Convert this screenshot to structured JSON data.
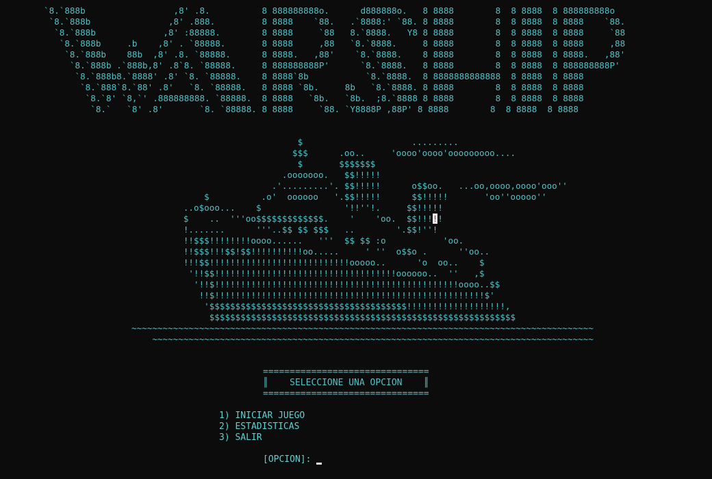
{
  "title_art": [
    "`8.`888b                 ,8' .8.          8 888888888o.      d888888o.   8 8888        8  8 8888  8 888888888o",
    " `8.`888b               ,8' .888.         8 8888    `88.   .`8888:' `88. 8 8888        8  8 8888  8 8888    `88.",
    "  `8.`888b             ,8' :88888.        8 8888     `88   8.`8888.   Y8 8 8888        8  8 8888  8 8888     `88",
    "   `8.`888b     .b    ,8' . `88888.       8 8888     ,88   `8.`8888.     8 8888        8  8 8888  8 8888     ,88",
    "    `8.`888b    88b  ,8' .8. `88888.      8 8888.   ,88'    `8.`8888.    8 8888        8  8 8888  8 8888.   ,88'",
    "     `8.`888b .`888b,8' .8`8. `88888.     8 888888888P'      `8.`8888.   8 8888        8  8 8888  8 888888888P'",
    "      `8.`888b8.`8888' .8' `8. `88888.    8 8888`8b           `8.`8888.  8 8888888888888  8 8888  8 8888",
    "       `8.`888`8.`88' .8'   `8. `88888.   8 8888 `8b.     8b   `8.`8888. 8 8888        8  8 8888  8 8888",
    "        `8.`8' `8,`' .888888888. `88888.  8 8888   `8b.   `8b.  ;8.`8888 8 8888        8  8 8888  8 8888",
    "         `8.`   `8' .8'       `8. `88888. 8 8888     `88. `Y8888P ,88P' 8 8888        8  8 8888  8 8888"
  ],
  "ship_art_before_cursor": [
    "                                $                     .........",
    "                               $$$      .oo..     'oooo'oooo'ooooooooo....",
    "                                $       $$$$$$$",
    "                             .ooooooo.   $$!!!!!",
    "                           .'.........'. $$!!!!!      o$$oo.   ...oo,oooo,oooo'ooo''",
    "              $          .o'  oooooo   '.$$!!!!!      $$!!!!!       'oo''ooooo''",
    "          ..o$ooo...    $                '!!''!.     $$!!!!!",
    "          $    ..  '''oo$$$$$$$$$$$$$.    '    'oo.  $$!!!"
  ],
  "ship_cursor_char": "!",
  "ship_cursor_after": "!",
  "ship_art_after": [
    "          !.......      '''..$$ $$ $$$   ..        '.$$!''!",
    "          !!$$$!!!!!!!!oooo......   '''  $$ $$ :o           'oo.",
    "          !!$$$!!!$$!$$!!!!!!!!!!oo.....     ' ''  o$$o .      ''oo..",
    "          !!!$$!!!!!!!!!!!!!!!!!!!!!!!!!!!ooooo..      'o  oo..    $",
    "           '!!$$!!!!!!!!!!!!!!!!!!!!!!!!!!!!!!!!!!!oooooo..  ''   ,$",
    "            '!!$!!!!!!!!!!!!!!!!!!!!!!!!!!!!!!!!!!!!!!!!!!!!!!!oooo..$$",
    "             !!$!!!!!!!!!!!!!!!!!!!!!!!!!!!!!!!!!!!!!!!!!!!!!!!!!!!!$'",
    "              '$$$$$$$$$$$$$$$$$$$$$$$$$$$$$$$$$$$$$$!!!!!!!!!!!!!!!!!!!,",
    "               $$$$$$$$$$$$$$$$$$$$$$$$$$$$$$$$$$$$$$$$$$$$$$$$$$$$$$$$$$$",
    "~~~~~~~~~~~~~~~~~~~~~~~~~~~~~~~~~~~~~~~~~~~~~~~~~~~~~~~~~~~~~~~~~~~~~~~~~~~~~~~~~~~~~~~~~",
    "    ~~~~~~~~~~~~~~~~~~~~~~~~~~~~~~~~~~~~~~~~~~~~~~~~~~~~~~~~~~~~~~~~~~~~~~~~~~~~~~~~~~~~~"
  ],
  "menu": {
    "border_line": "===============================",
    "title_line": "║    SELECCIONE UNA OPCION    ║",
    "options": [
      {
        "label": "1) INICIAR JUEGO"
      },
      {
        "label": "2) ESTADISTICAS"
      },
      {
        "label": "3) SALIR"
      }
    ],
    "prompt": "[OPCION]:"
  },
  "colors": {
    "background": "#0c0c0c",
    "text": "#4fc3c8",
    "cursor_bg": "#e8e8e8",
    "cursor_fg": "#c0392b"
  }
}
